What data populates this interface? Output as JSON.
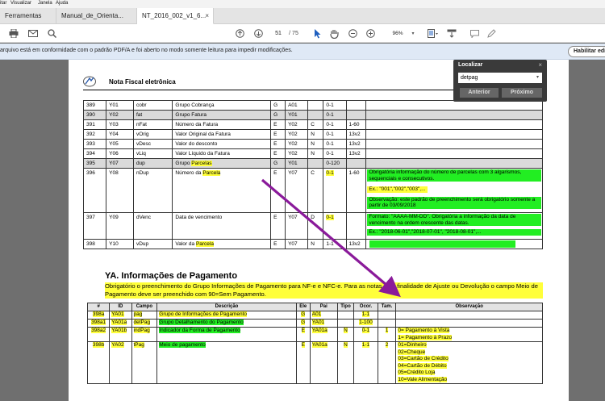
{
  "menubar": {
    "items": [
      "itar",
      "Visualizar",
      "Janela",
      "Ajuda"
    ]
  },
  "tabs": [
    {
      "label": "Ferramentas"
    },
    {
      "label": "Manual_de_Orienta..."
    },
    {
      "label": "NT_2016_002_v1_6...",
      "close": "×"
    }
  ],
  "toolbar": {
    "page_current": "51",
    "page_total": "/ 75",
    "zoom": "96%"
  },
  "infobar": {
    "message": "arquivo está em conformidade com o padrão PDF/A e foi aberto no modo somente leitura para impedir modificações.",
    "button": "Habilitar edição"
  },
  "find": {
    "title": "Localizar",
    "close": "×",
    "query": "detpag",
    "prev": "Anterior",
    "next": "Próximo"
  },
  "page": {
    "header_title": "Nota Fiscal eletrônica",
    "table1": [
      {
        "n": "389",
        "id": "Y01",
        "campo": "cobr",
        "desc": "Grupo Cobrança",
        "ele": "G",
        "pai": "A01",
        "tipo": "",
        "ocor": "0-1",
        "tam": "",
        "grey": false
      },
      {
        "n": "390",
        "id": "Y02",
        "campo": "fat",
        "desc": "Grupo Fatura",
        "ele": "G",
        "pai": "Y01",
        "tipo": "",
        "ocor": "0-1",
        "tam": "",
        "grey": true
      },
      {
        "n": "391",
        "id": "Y03",
        "campo": "nFat",
        "desc": "Número da Fatura",
        "ele": "E",
        "pai": "Y02",
        "tipo": "C",
        "ocor": "0-1",
        "tam": "1-60",
        "grey": false
      },
      {
        "n": "392",
        "id": "Y04",
        "campo": "vOrig",
        "desc": "Valor Original da Fatura",
        "ele": "E",
        "pai": "Y02",
        "tipo": "N",
        "ocor": "0-1",
        "tam": "13v2",
        "grey": false
      },
      {
        "n": "393",
        "id": "Y05",
        "campo": "vDesc",
        "desc": "Valor do desconto",
        "ele": "E",
        "pai": "Y02",
        "tipo": "N",
        "ocor": "0-1",
        "tam": "13v2",
        "grey": false
      },
      {
        "n": "394",
        "id": "Y06",
        "campo": "vLiq",
        "desc": "Valor Líquido da Fatura",
        "ele": "E",
        "pai": "Y02",
        "tipo": "N",
        "ocor": "0-1",
        "tam": "13v2",
        "grey": false
      },
      {
        "n": "395",
        "id": "Y07",
        "campo": "dup",
        "desc_pre": "Grupo ",
        "desc_hl": "Parcelas",
        "ele": "G",
        "pai": "Y01",
        "tipo": "",
        "ocor": "0-120",
        "tam": "",
        "grey": true
      }
    ],
    "row396": {
      "n": "396",
      "id": "Y08",
      "campo": "nDup",
      "desc_pre": "Número da ",
      "desc_hl": "Parcela",
      "ele": "E",
      "pai": "Y07",
      "tipo": "C",
      "ocor": "0-1",
      "tam": "1-60",
      "obs1": "Obrigatória informação do número de parcelas com 3 algarismos, sequenciais e consecutivos.",
      "obs2": "Ex.: \"001\",\"002\",\"003\",...",
      "obs3": "Observação: este padrão de preenchimento será obrigatório somente a partir de 03/09/2018"
    },
    "row397": {
      "n": "397",
      "id": "Y09",
      "campo": "dVenc",
      "desc": "Data de vencimento",
      "ele": "E",
      "pai": "Y07",
      "tipo": "D",
      "ocor": "0-1",
      "tam": "",
      "obs1": "Formato: \"AAAA-MM-DD\". Obrigatória a informação da data de vencimento na ordem crescente das datas.",
      "obs2": "Ex.: \"2018-06-01\",\"2018-07-01\", \"2018-08-01\",..."
    },
    "row398": {
      "n": "398",
      "id": "Y10",
      "campo": "vDup",
      "desc_pre": "Valor da ",
      "desc_hl": "Parcela",
      "ele": "E",
      "pai": "Y07",
      "tipo": "N",
      "ocor": "1-1",
      "tam": "13v2"
    },
    "section_title": "YA. Informações de Pagamento",
    "section_desc": "Obrigatório o preenchimento do Grupo Informações de Pagamento para NF-e e NFC-e. Para as notas com finalidade de Ajuste ou Devolução o campo Meio de Pagamento deve ser preenchido com 90=Sem Pagamento.",
    "table2_headers": [
      "#",
      "ID",
      "Campo",
      "Descrição",
      "Ele",
      "Pai",
      "Tipo",
      "Ocor.",
      "Tam.",
      "Observação"
    ],
    "table2": [
      {
        "n": "398a",
        "id": "YA01",
        "campo": "pag",
        "desc": "Grupo de Informações de Pagamento",
        "ele": "G",
        "pai": "A01",
        "tipo": "",
        "ocor": "1-1",
        "tam": "",
        "obs": []
      },
      {
        "n": "398a1",
        "id": "YA01a",
        "campo": "detPag",
        "desc": "Grupo Detalhamento do Pagamento",
        "ele": "G",
        "pai": "YA01",
        "tipo": "",
        "ocor": "1-100",
        "tam": "",
        "obs": []
      },
      {
        "n": "398a2",
        "id": "YA01b",
        "campo": "indPag",
        "desc": "Indicador da Forma de Pagamento",
        "ele": "E",
        "pai": "YA01a",
        "tipo": "N",
        "ocor": "0-1",
        "tam": "1",
        "obs": [
          "0= Pagamento à Vista",
          "1= Pagamento à Prazo"
        ]
      },
      {
        "n": "398b",
        "id": "YA02",
        "campo": "tPag",
        "desc": "Meio de pagamento",
        "ele": "E",
        "pai": "YA01a",
        "tipo": "N",
        "ocor": "1-1",
        "tam": "2",
        "obs": [
          "01=Dinheiro",
          "02=Cheque",
          "03=Cartão de Crédito",
          "04=Cartão de Débito",
          "05=Crédito Loja",
          "10=Vale Alimentação"
        ]
      }
    ]
  },
  "colors": {
    "highlight_yellow": "#ffff3a",
    "highlight_green": "#22ee22",
    "arrow": "#8a1a9a",
    "info_bg": "#dfe9f6"
  }
}
